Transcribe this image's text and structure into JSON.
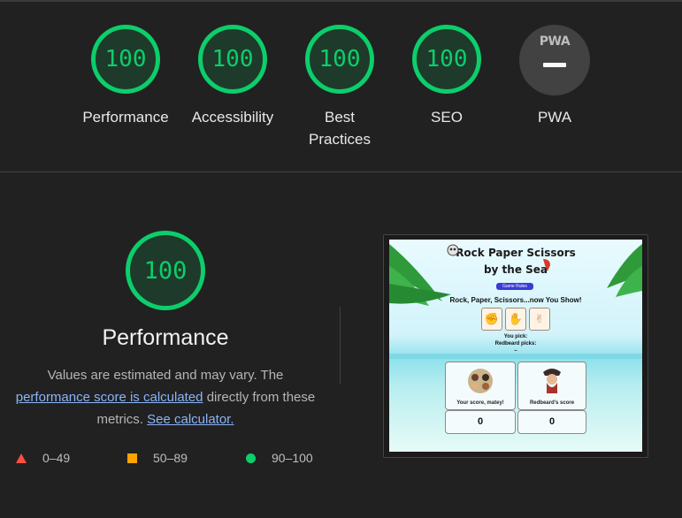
{
  "categories": [
    {
      "label": "Performance",
      "score": "100"
    },
    {
      "label": "Accessibility",
      "score": "100"
    },
    {
      "label": "Best Practices",
      "score": "100"
    },
    {
      "label": "SEO",
      "score": "100"
    },
    {
      "label": "PWA",
      "badge_text": "PWA"
    }
  ],
  "main": {
    "score": "100",
    "title": "Performance",
    "desc_1": "Values are estimated and may vary. The",
    "desc_link_1": "performance score is calculated",
    "desc_2": "directly from these metrics.",
    "desc_link_2": "See calculator."
  },
  "legend": {
    "fail": "0–49",
    "average": "50–89",
    "pass": "90–100"
  },
  "screenshot": {
    "title_1": "Rock Paper Scissors",
    "title_2": "by the Sea",
    "rules_button": "Game Rules",
    "subtitle": "Rock, Paper, Scissors...now You Show!",
    "you_pick": "You pick:",
    "redbeard_picks": "Redbeard picks:",
    "dash": "–",
    "your_score_label": "Your score, matey!",
    "redbeard_score_label": "Redbeard's score",
    "your_score": "0",
    "redbeard_score": "0"
  },
  "colors": {
    "pass": "#0cce6b",
    "average": "#ffa400",
    "fail": "#ff4e42",
    "background": "#212121"
  }
}
